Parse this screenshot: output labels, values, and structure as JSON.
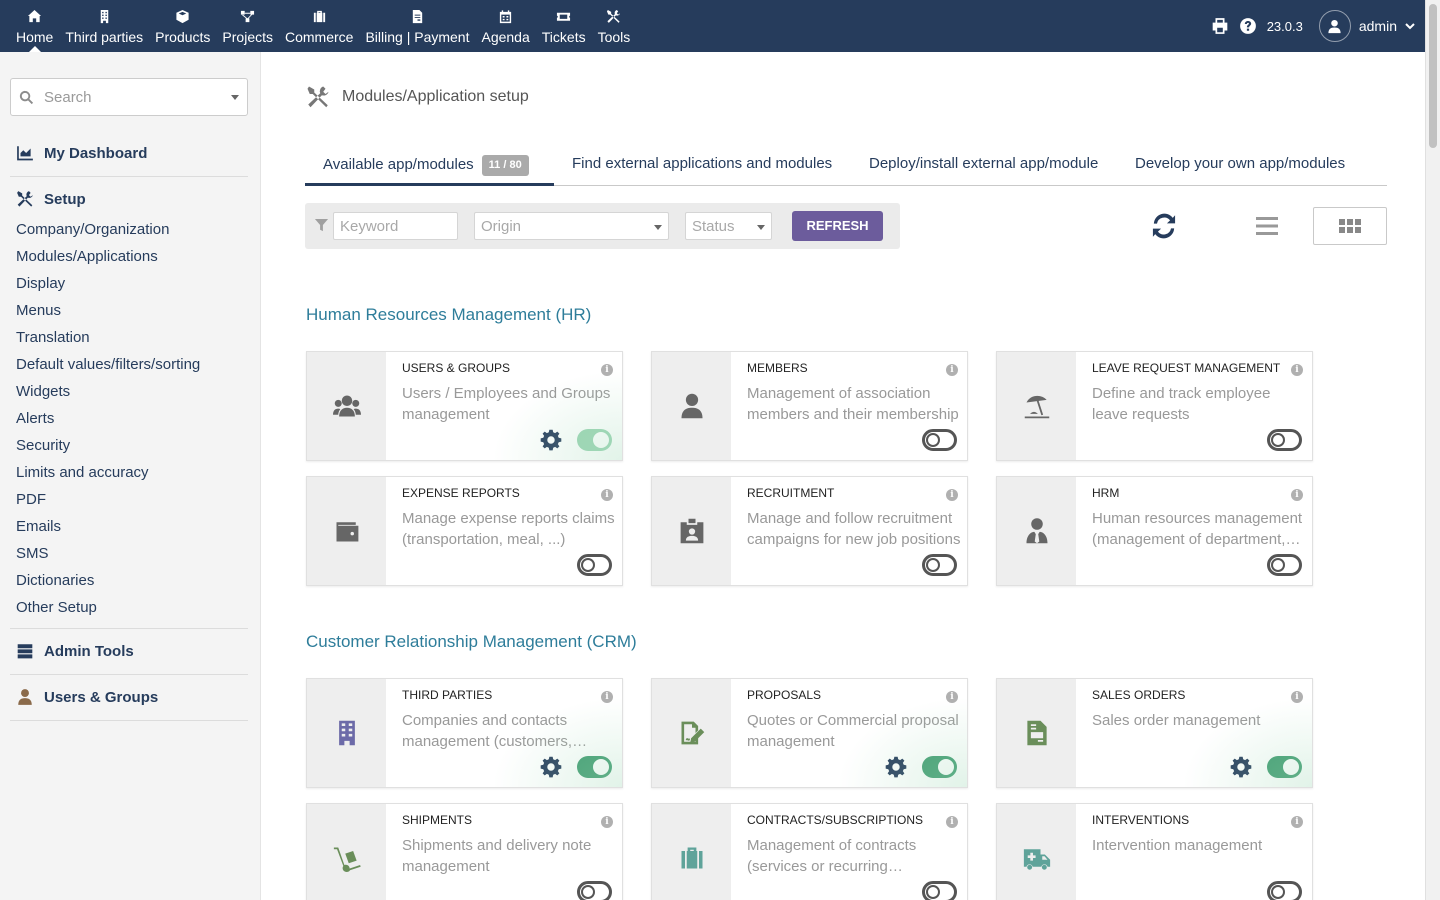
{
  "topnav": [
    {
      "label": "Home",
      "icon": "home-icon"
    },
    {
      "label": "Third parties",
      "icon": "building-icon"
    },
    {
      "label": "Products",
      "icon": "cube-icon"
    },
    {
      "label": "Projects",
      "icon": "project-icon"
    },
    {
      "label": "Commerce",
      "icon": "suitcase-icon"
    },
    {
      "label": "Billing | Payment",
      "icon": "invoice-icon"
    },
    {
      "label": "Agenda",
      "icon": "calendar-icon"
    },
    {
      "label": "Tickets",
      "icon": "ticket-icon"
    },
    {
      "label": "Tools",
      "icon": "tools-icon"
    }
  ],
  "topright": {
    "version": "23.0.3",
    "username": "admin"
  },
  "sidebar": {
    "search_placeholder": "Search",
    "dashboard": "My Dashboard",
    "setup": "Setup",
    "setup_items": [
      "Company/Organization",
      "Modules/Applications",
      "Display",
      "Menus",
      "Translation",
      "Default values/filters/sorting",
      "Widgets",
      "Alerts",
      "Security",
      "Limits and accuracy",
      "PDF",
      "Emails",
      "SMS",
      "Dictionaries",
      "Other Setup"
    ],
    "admin_tools": "Admin Tools",
    "users_groups": "Users & Groups"
  },
  "page": {
    "title": "Modules/Application setup"
  },
  "tabs": {
    "available": "Available app/modules",
    "available_badge": "11 / 80",
    "find": "Find external applications and modules",
    "deploy": "Deploy/install external app/module",
    "develop": "Develop your own app/modules"
  },
  "filters": {
    "keyword": "Keyword",
    "origin": "Origin",
    "status": "Status",
    "refresh": "REFRESH"
  },
  "sections": {
    "hr": "Human Resources Management (HR)",
    "crm": "Customer Relationship Management (CRM)"
  },
  "cards": [
    {
      "title": "USERS & GROUPS",
      "desc": "Users / Employees and Groups management",
      "icon": "users-icon",
      "color": "#666666",
      "enabled": true,
      "faded": true
    },
    {
      "title": "MEMBERS",
      "desc": "Management of association members and their membership",
      "icon": "user-icon",
      "color": "#666666",
      "enabled": false
    },
    {
      "title": "LEAVE REQUEST MANAGEMENT",
      "desc": "Define and track employee leave requests",
      "icon": "umbrella-beach-icon",
      "color": "#666666",
      "enabled": false
    },
    {
      "title": "EXPENSE REPORTS",
      "desc": "Manage expense reports claims (transportation, meal, ...)",
      "icon": "wallet-icon",
      "color": "#666666",
      "enabled": false
    },
    {
      "title": "RECRUITMENT",
      "desc": "Manage and follow recruitment campaigns for new job positions",
      "icon": "id-badge-icon",
      "color": "#666666",
      "enabled": false
    },
    {
      "title": "HRM",
      "desc": "Human resources management (management of department, employee contracts, ...)",
      "icon": "user-tie-icon",
      "color": "#666666",
      "enabled": false
    },
    {
      "title": "THIRD PARTIES",
      "desc": "Companies and contacts management (customers, prospects, suppliers)",
      "icon": "building-icon",
      "color": "#6c6aa8",
      "enabled": true
    },
    {
      "title": "PROPOSALS",
      "desc": "Quotes or Commercial proposal management",
      "icon": "file-signature-icon",
      "color": "#6a8e5a",
      "enabled": true
    },
    {
      "title": "SALES ORDERS",
      "desc": "Sales order management",
      "icon": "file-invoice-icon",
      "color": "#6a8e5a",
      "enabled": true
    },
    {
      "title": "SHIPMENTS",
      "desc": "Shipments and delivery note management",
      "icon": "dolly-icon",
      "color": "#6a8e5a",
      "enabled": false
    },
    {
      "title": "CONTRACTS/SUBSCRIPTIONS",
      "desc": "Management of contracts (services or recurring subscriptions)",
      "icon": "suitcase-icon",
      "color": "#5fa39a",
      "enabled": false
    },
    {
      "title": "INTERVENTIONS",
      "desc": "Intervention management",
      "icon": "ambulance-icon",
      "color": "#5fa39a",
      "enabled": false
    }
  ]
}
